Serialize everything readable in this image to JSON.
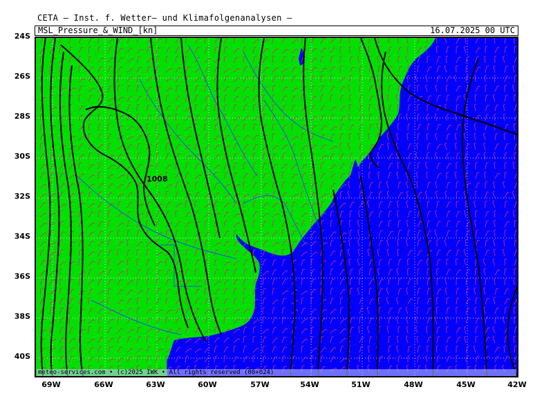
{
  "header": {
    "line1": "CETA — Inst. f. Wetter— und Klimafolgenanalysen —",
    "product": "MSL_Pressure_&_WIND_[kn]",
    "timestamp": "16.07.2025 00 UTC"
  },
  "footer": {
    "credit": "meteo-services.com • (c)2025 IWK • All rights reserved (00+024)"
  },
  "axes": {
    "lat_labels": [
      "24S",
      "26S",
      "28S",
      "30S",
      "32S",
      "34S",
      "36S",
      "38S",
      "40S"
    ],
    "lon_labels": [
      "69W",
      "66W",
      "63W",
      "60W",
      "57W",
      "54W",
      "51W",
      "48W",
      "45W",
      "42W"
    ]
  },
  "isobar_labels": [
    {
      "text": "1008"
    }
  ],
  "colors": {
    "land": "#00e000",
    "ocean": "#0000ff",
    "isobar": "#000000",
    "wind_barbs": "#d0307a",
    "rivers_borders": "#1a4aff",
    "grid": "#ffffff"
  }
}
